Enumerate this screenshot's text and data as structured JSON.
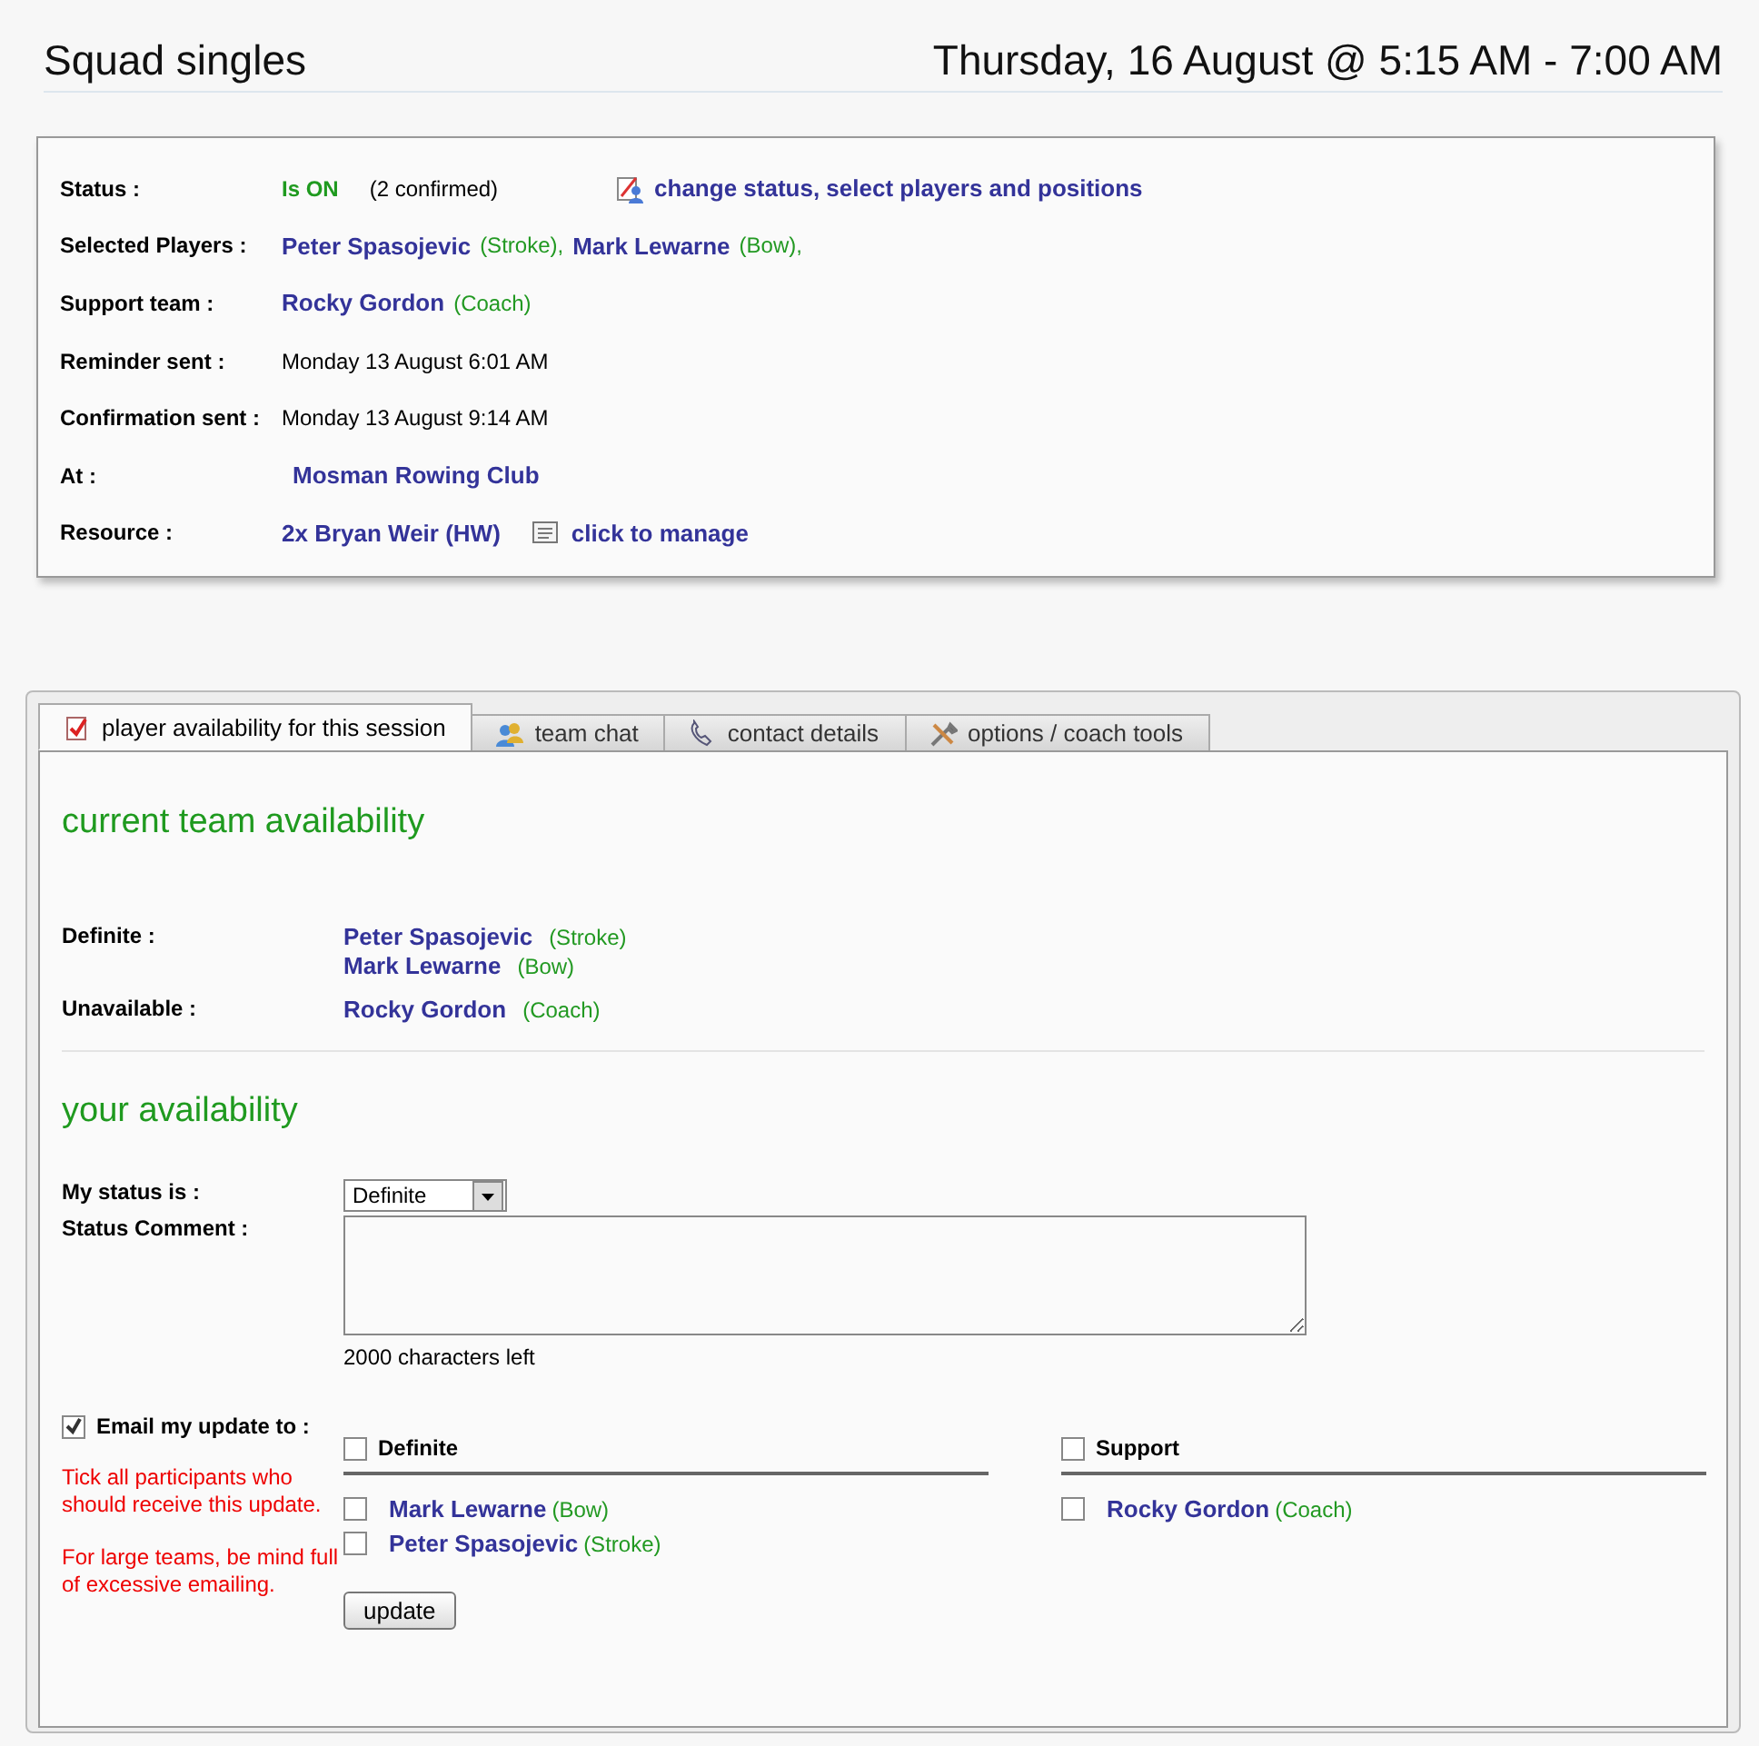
{
  "header": {
    "title": "Squad singles",
    "datetime": "Thursday, 16 August @ 5:15 AM - 7:00 AM"
  },
  "summary": [
    {
      "label": "Status :",
      "items": [
        {
          "kind": "status",
          "text": "Is ON"
        },
        {
          "kind": "note",
          "text": "(2 confirmed)"
        },
        {
          "kind": "edit-action",
          "text": "change status, select players and positions"
        }
      ]
    },
    {
      "label": "Selected Players :",
      "items": [
        {
          "kind": "person",
          "text": "Peter Spasojevic"
        },
        {
          "kind": "role",
          "text": "(Stroke),"
        },
        {
          "kind": "person",
          "text": "Mark Lewarne"
        },
        {
          "kind": "role",
          "text": "(Bow),"
        }
      ]
    },
    {
      "label": "Support team :",
      "items": [
        {
          "kind": "person",
          "text": "Rocky Gordon"
        },
        {
          "kind": "role",
          "text": "(Coach)"
        }
      ]
    },
    {
      "label": "Reminder sent :",
      "items": [
        {
          "kind": "date",
          "text": "Monday 13 August 6:01 AM"
        }
      ]
    },
    {
      "label": "Confirmation sent :",
      "items": [
        {
          "kind": "date",
          "text": "Monday 13 August 9:14 AM"
        }
      ]
    },
    {
      "label": "At :",
      "items": [
        {
          "kind": "place",
          "text": "Mosman Rowing Club"
        }
      ]
    },
    {
      "label": "Resource :",
      "items": [
        {
          "kind": "person",
          "text": "2x Bryan Weir (HW)"
        },
        {
          "kind": "manage-action",
          "text": "click to manage"
        }
      ]
    }
  ],
  "tabs": [
    {
      "label": "player availability for this session",
      "selected": true
    },
    {
      "label": "team chat",
      "selected": false
    },
    {
      "label": "contact details",
      "selected": false
    },
    {
      "label": "options / coach tools",
      "selected": false
    }
  ],
  "team_availability": {
    "heading": "current team availability",
    "groups": [
      {
        "label": "Definite :",
        "people": [
          {
            "name": "Peter Spasojevic",
            "role": "(Stroke)"
          },
          {
            "name": "Mark Lewarne",
            "role": "(Bow)"
          }
        ]
      },
      {
        "label": "Unavailable :",
        "people": [
          {
            "name": "Rocky Gordon",
            "role": "(Coach)"
          }
        ]
      }
    ]
  },
  "your_availability": {
    "heading": "your availability",
    "status_label": "My status is :",
    "status_value": "Definite",
    "comment_label": "Status Comment :",
    "chars_left": "2000 characters left",
    "email": {
      "label": "Email my update to :",
      "checked": true
    },
    "hints": [
      "Tick all participants who should receive this update.",
      "For large teams, be mind full of excessive emailing."
    ],
    "columns": [
      {
        "heading": "Definite",
        "checked": false,
        "people": [
          {
            "name": "Mark Lewarne",
            "role": "(Bow)",
            "checked": false
          },
          {
            "name": "Peter Spasojevic",
            "role": "(Stroke)",
            "checked": false
          }
        ]
      },
      {
        "heading": "Support",
        "checked": false,
        "people": [
          {
            "name": "Rocky Gordon",
            "role": "(Coach)",
            "checked": false
          }
        ]
      }
    ],
    "button": "update"
  }
}
